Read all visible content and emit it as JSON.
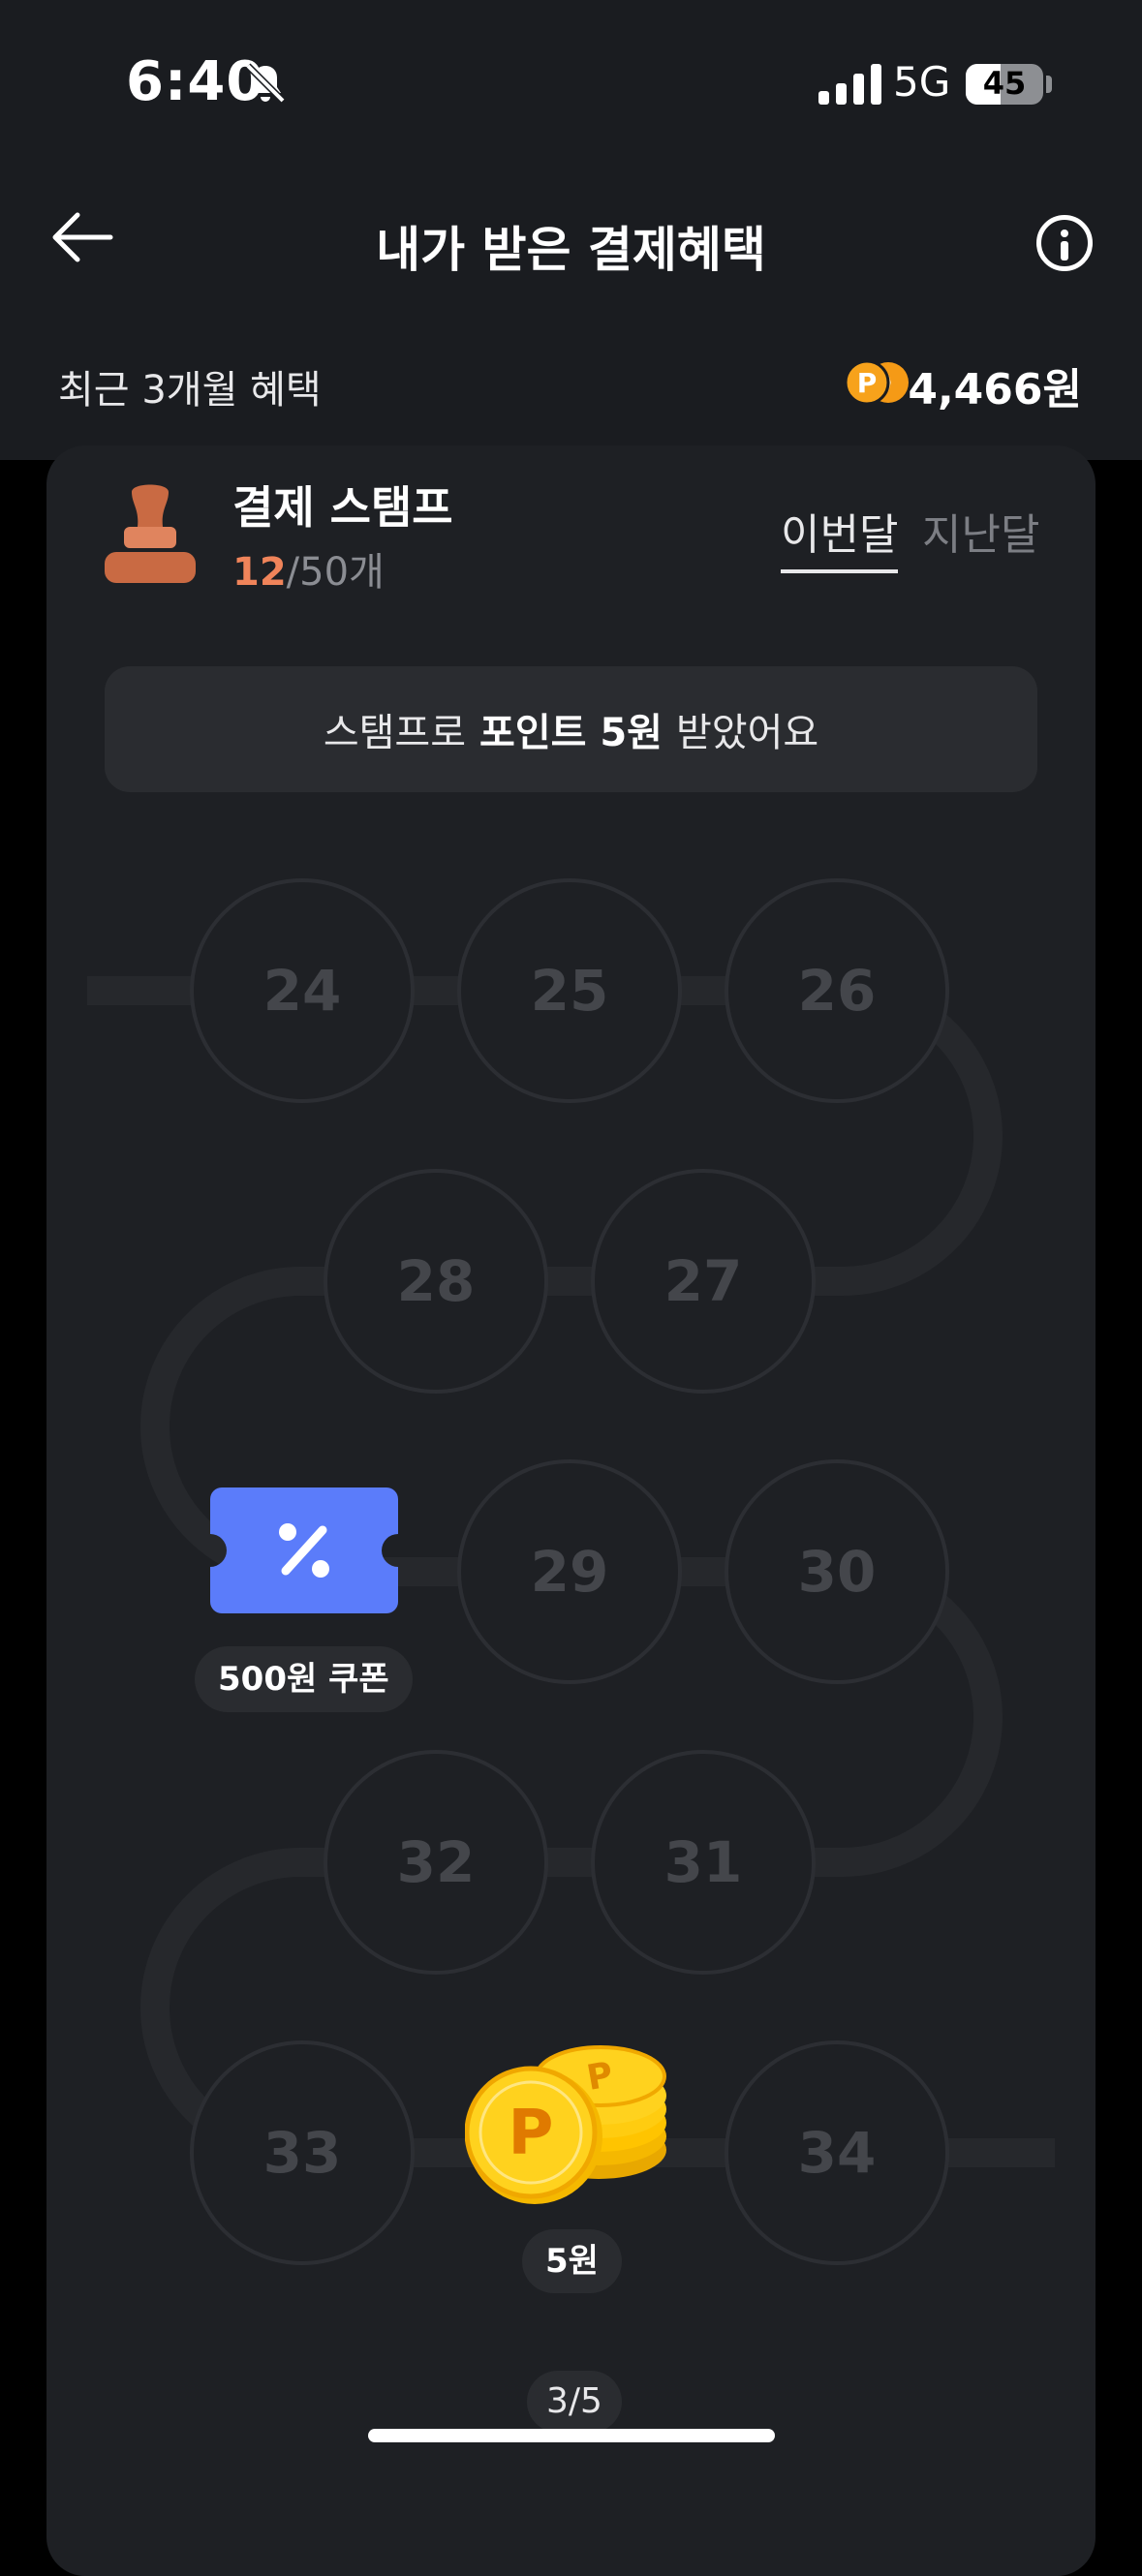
{
  "status_bar": {
    "time": "6:40",
    "network": "5G",
    "battery": "45",
    "battery_level": 0.45,
    "icons": [
      "bell-slash-icon",
      "signal-icon",
      "battery-icon"
    ]
  },
  "header": {
    "title": "내가 받은 결제혜택",
    "icons": [
      "back-arrow-icon",
      "info-icon"
    ]
  },
  "summary": {
    "label": "최근 3개월 혜택",
    "amount": "4,466원"
  },
  "stamp_card": {
    "title": "결제 스탬프",
    "count_current": "12",
    "count_total": "/50개",
    "tabs": [
      "이번달",
      "지난달"
    ],
    "active_tab": 0,
    "banner_prefix": "스탬프로",
    "banner_bold": "포인트 5원",
    "banner_suffix": "받았어요",
    "stamps": [
      "24",
      "25",
      "26",
      "28",
      "27",
      "29",
      "30",
      "32",
      "31",
      "33",
      "34"
    ],
    "coupon_label": "500원 쿠폰",
    "coin_label": "5원",
    "page_indicator": "3/5"
  },
  "colors": {
    "background": "#1a1c20",
    "card": "#1e2024",
    "accent_orange": "#f0845a",
    "coupon_blue": "#5b7cfa",
    "coin_yellow": "#ffd21e"
  }
}
